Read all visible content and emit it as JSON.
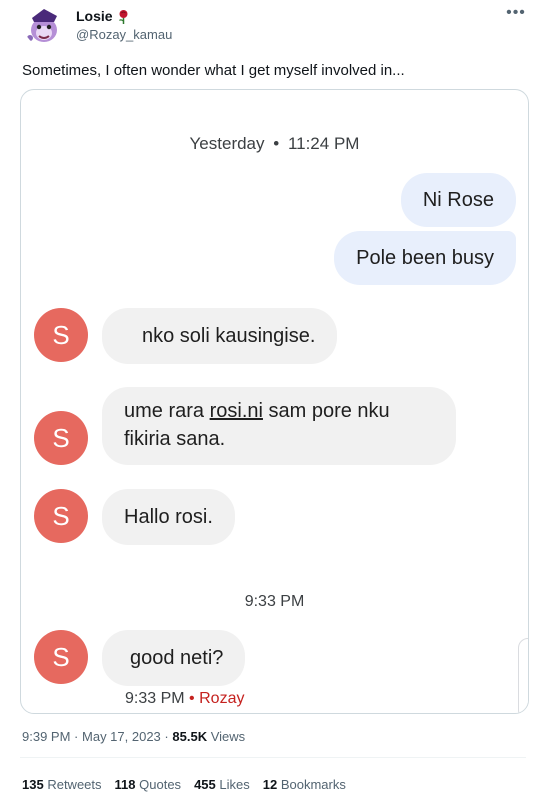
{
  "author": {
    "display_name": "Losie",
    "handle": "@Rozay_kamau",
    "badge_icon": "rose-icon",
    "avatar_icon": "cartoon-avatar"
  },
  "more_icon": "more-horizontal-icon",
  "tweet_text": "Sometimes, I often wonder what I get myself involved in...",
  "screenshot": {
    "header_day": "Yesterday",
    "header_sep": "•",
    "header_time": "11:24 PM",
    "outgoing": [
      "Ni Rose",
      "Pole been busy"
    ],
    "incoming": [
      {
        "avatar_letter": "S",
        "text": "nko soli kausingise."
      },
      {
        "avatar_letter": "S",
        "text_pre": "ume rara ",
        "link": "rosi.ni",
        "text_post": " sam pore nku fikiria sana."
      },
      {
        "avatar_letter": "S",
        "text": "Hallo rosi."
      }
    ],
    "mid_timestamp": "9:33 PM",
    "last": {
      "avatar_letter": "S",
      "text": "good neti?"
    },
    "footer_time": "9:33 PM",
    "footer_sep": "•",
    "footer_sender": "Rozay",
    "colors": {
      "avatar": "#e6695f",
      "outgoing_bubble": "#e8effc",
      "incoming_bubble": "#f1f1f1",
      "sender": "#c5221f"
    }
  },
  "meta": {
    "time": "9:39 PM",
    "sep": "·",
    "date": "May 17, 2023",
    "sep2": "·",
    "views_count": "85.5K",
    "views_label": "Views"
  },
  "stats": [
    {
      "count": "135",
      "label": "Retweets"
    },
    {
      "count": "118",
      "label": "Quotes"
    },
    {
      "count": "455",
      "label": "Likes"
    },
    {
      "count": "12",
      "label": "Bookmarks"
    }
  ]
}
